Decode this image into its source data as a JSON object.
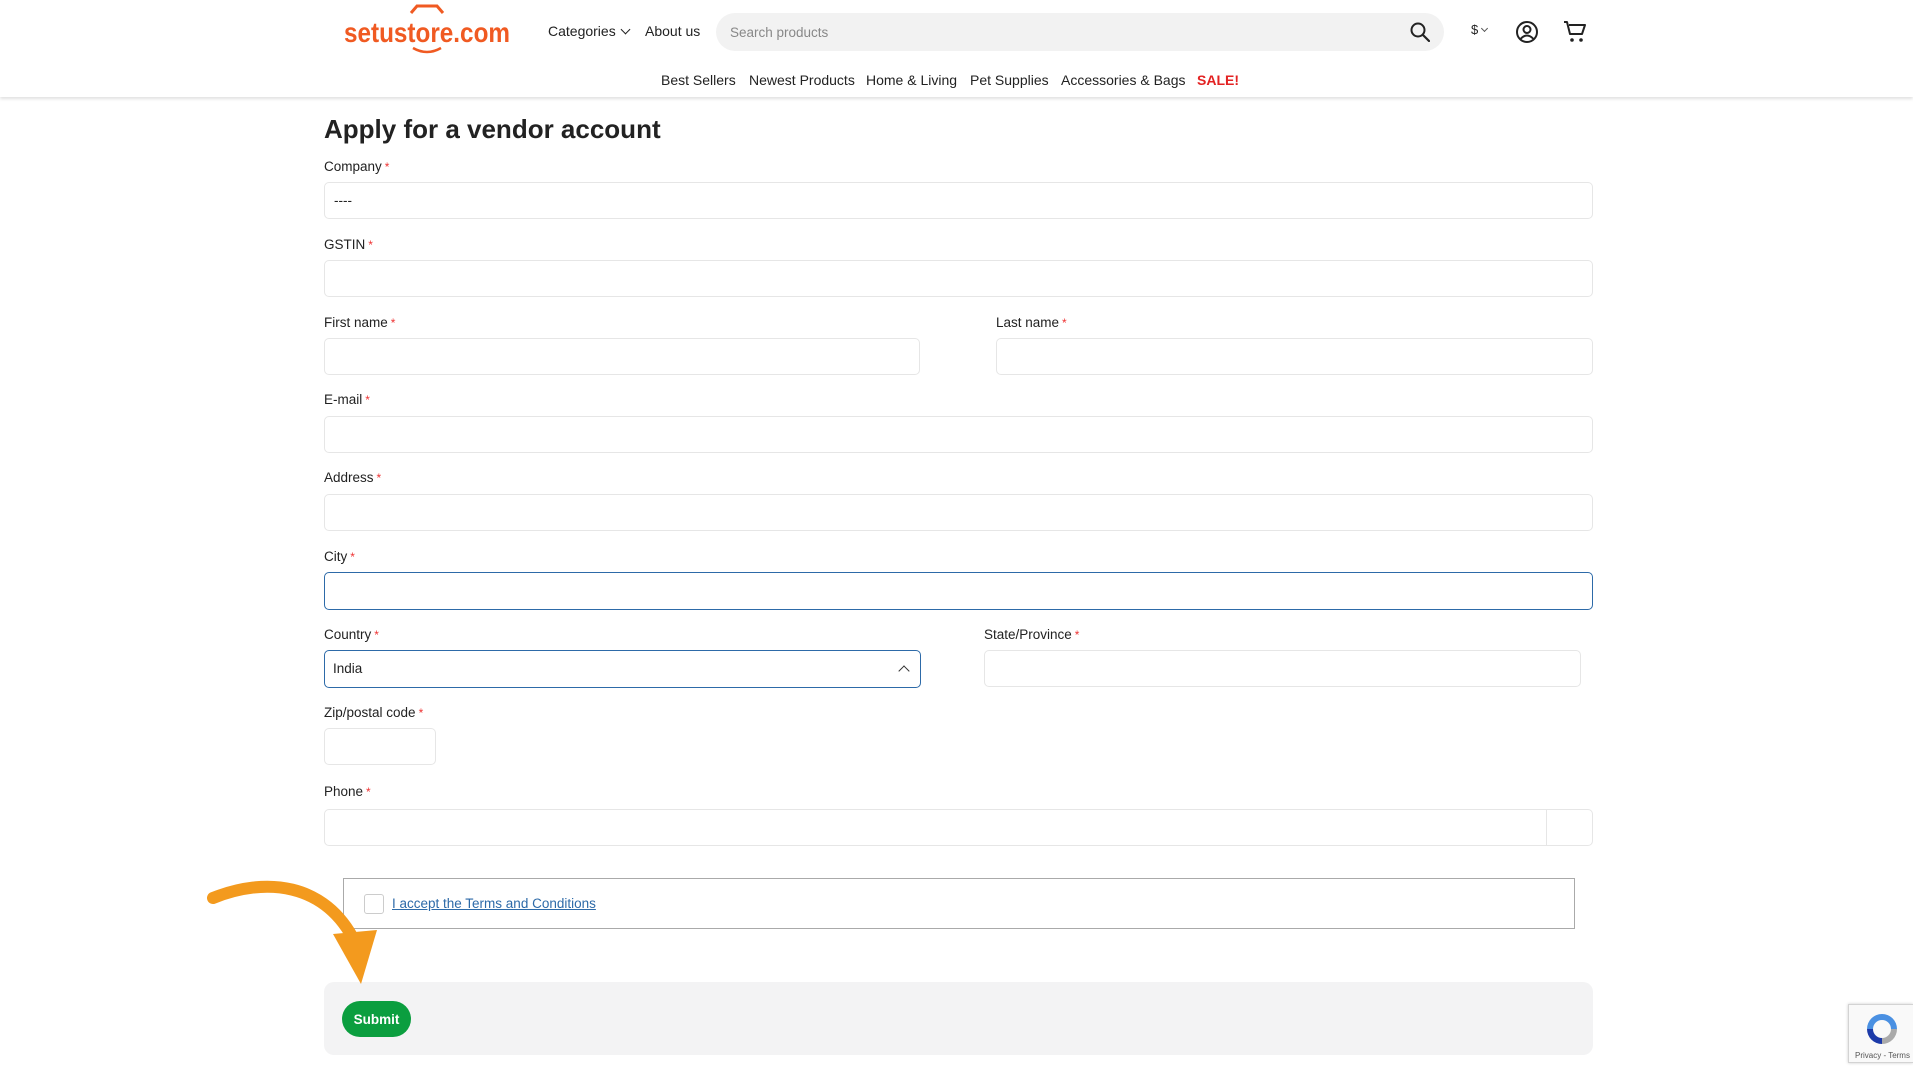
{
  "header": {
    "logo_text": "setustore.com",
    "categories_label": "Categories",
    "about_label": "About us",
    "search_placeholder": "Search products",
    "currency": "$",
    "category_nav": [
      "Best Sellers",
      "Newest Products",
      "Home & Living",
      "Pet Supplies",
      "Accessories & Bags",
      "SALE!"
    ]
  },
  "colors": {
    "brand_orange": "#f05a22",
    "sale_red": "#e32222",
    "submit_green": "#0b9e3f",
    "focus_blue": "#2d6aa8",
    "arrow_orange": "#f39a1e"
  },
  "form": {
    "title": "Apply for a vendor account",
    "required_mark": "*",
    "company": {
      "label": "Company",
      "value": "----"
    },
    "gstin": {
      "label": "GSTIN",
      "value": ""
    },
    "first_name": {
      "label": "First name",
      "value": ""
    },
    "last_name": {
      "label": "Last name",
      "value": ""
    },
    "email": {
      "label": "E-mail",
      "value": ""
    },
    "address": {
      "label": "Address",
      "value": ""
    },
    "city": {
      "label": "City",
      "value": ""
    },
    "country": {
      "label": "Country",
      "value": "India"
    },
    "state": {
      "label": "State/Province",
      "value": ""
    },
    "zip": {
      "label": "Zip/postal code",
      "value": ""
    },
    "phone": {
      "label": "Phone",
      "value": ""
    },
    "terms_label": "I accept the Terms and Conditions",
    "terms_checked": false,
    "submit_label": "Submit"
  },
  "recaptcha": {
    "text": "Privacy - Terms"
  }
}
